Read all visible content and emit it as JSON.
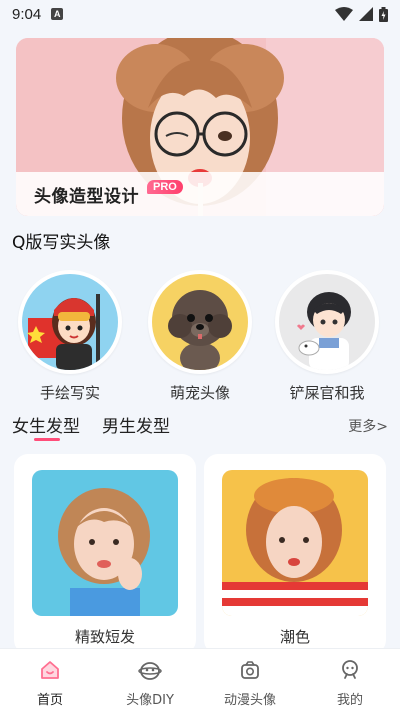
{
  "status_bar": {
    "time": "9:04",
    "notification_badge": "A"
  },
  "banner": {
    "title": "头像造型设计",
    "badge": "PRO"
  },
  "section": {
    "title": "Q版写实头像"
  },
  "categories": [
    {
      "label": "手绘写实"
    },
    {
      "label": "萌宠头像"
    },
    {
      "label": "铲屎官和我"
    }
  ],
  "tabs": {
    "female": "女生发型",
    "male": "男生发型",
    "more": "更多>"
  },
  "cards": [
    {
      "label": "精致短发"
    },
    {
      "label": "潮色"
    }
  ],
  "nav": [
    {
      "label": "首页",
      "icon": "home-icon"
    },
    {
      "label": "头像DIY",
      "icon": "alien-face-icon"
    },
    {
      "label": "动漫头像",
      "icon": "anime-camera-icon"
    },
    {
      "label": "我的",
      "icon": "profile-icon"
    }
  ],
  "colors": {
    "accent": "#ff4d79",
    "background": "#f3f6fb"
  }
}
